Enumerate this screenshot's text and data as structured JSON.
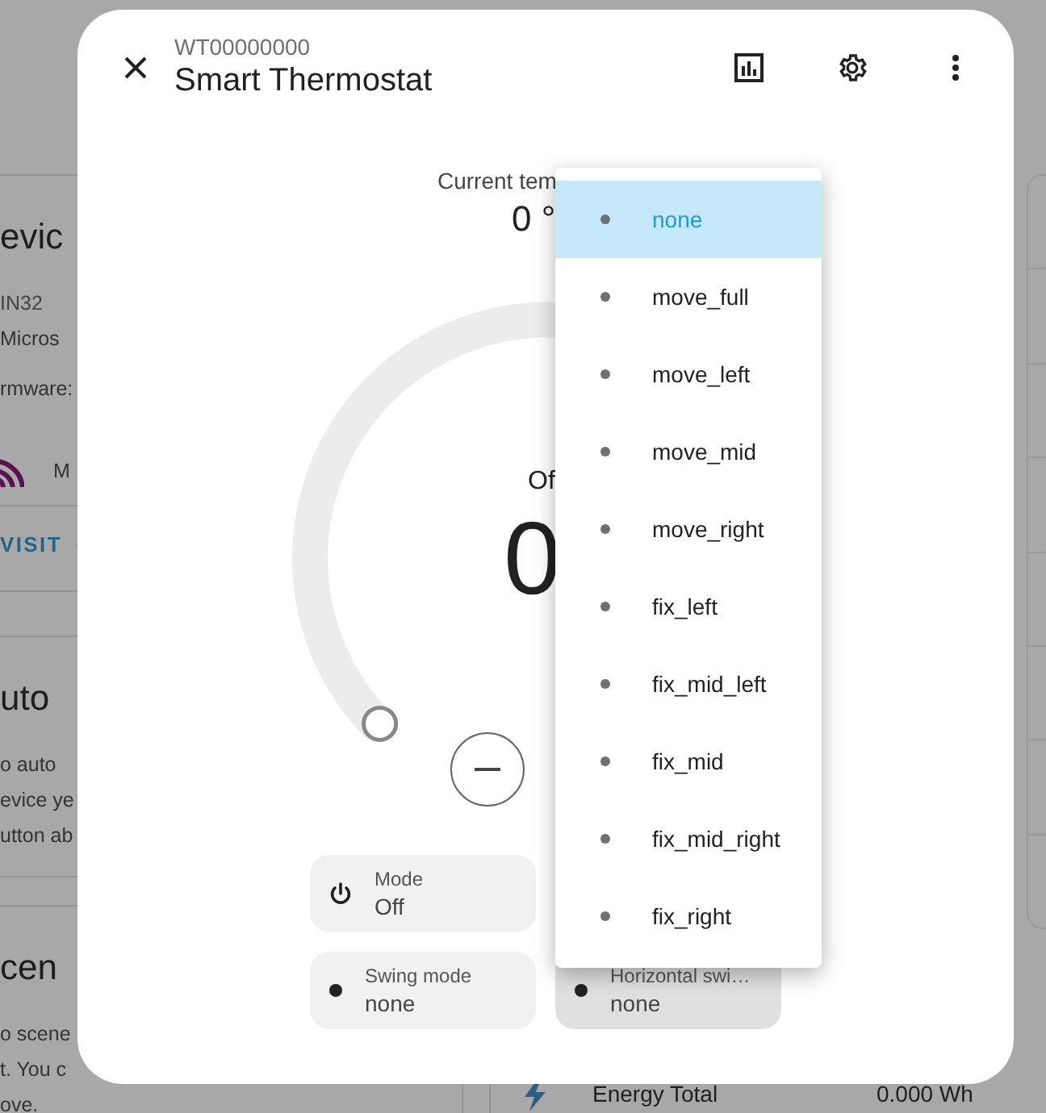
{
  "background": {
    "cards": [
      {
        "heading": "evic",
        "lines": [
          {
            "kind": "text",
            "text": "IN32"
          },
          {
            "kind": "text",
            "text": "Micros"
          },
          {
            "kind": "text",
            "text": "rmware:"
          },
          {
            "kind": "signal",
            "text": "M"
          },
          {
            "kind": "link",
            "text": "VISIT"
          }
        ]
      },
      {
        "heading": "uto",
        "lines": [
          {
            "kind": "text",
            "text": "o auto"
          },
          {
            "kind": "text",
            "text": "evice ye"
          },
          {
            "kind": "text",
            "text": "utton ab"
          }
        ]
      },
      {
        "heading": "cen",
        "lines": [
          {
            "kind": "text",
            "text": "o scene"
          },
          {
            "kind": "text",
            "text": "t. You c"
          },
          {
            "kind": "text",
            "text": "ove."
          }
        ]
      }
    ],
    "energy": {
      "label": "Energy Total",
      "value": "0.000 Wh"
    }
  },
  "dialog": {
    "subtitle": "WT00000000",
    "title": "Smart Thermostat",
    "current": {
      "label": "Current tem",
      "value": "0 °"
    },
    "dial": {
      "state": "Of",
      "target": "0"
    },
    "tiles": [
      {
        "label": "Mode",
        "value": "Off",
        "active": false
      },
      {
        "label": "Swing mode",
        "value": "none",
        "active": false
      },
      {
        "label": "Horizontal swi…",
        "value": "none",
        "active": true
      }
    ],
    "menu": {
      "items": [
        {
          "label": "none",
          "selected": true
        },
        {
          "label": "move_full",
          "selected": false
        },
        {
          "label": "move_left",
          "selected": false
        },
        {
          "label": "move_mid",
          "selected": false
        },
        {
          "label": "move_right",
          "selected": false
        },
        {
          "label": "fix_left",
          "selected": false
        },
        {
          "label": "fix_mid_left",
          "selected": false
        },
        {
          "label": "fix_mid",
          "selected": false
        },
        {
          "label": "fix_mid_right",
          "selected": false
        },
        {
          "label": "fix_right",
          "selected": false
        }
      ]
    }
  }
}
